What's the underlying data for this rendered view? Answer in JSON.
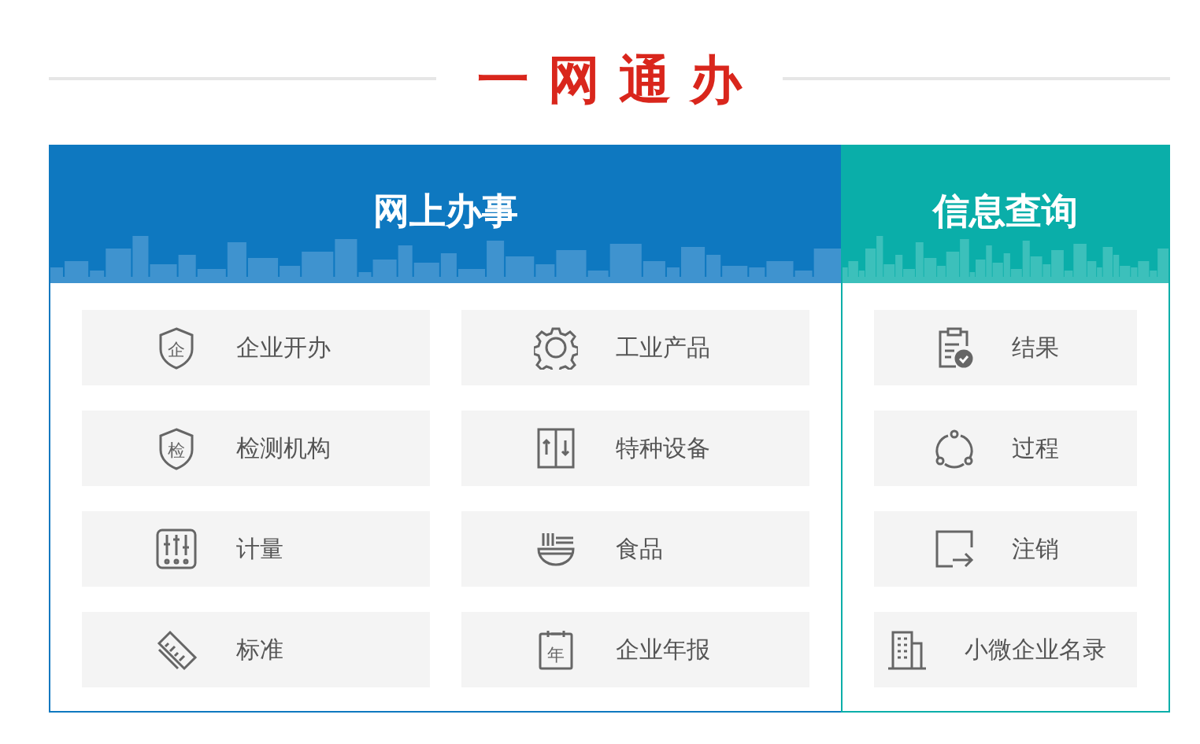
{
  "title": "一网通办",
  "panels": [
    {
      "title": "网上办事",
      "items": [
        {
          "label": "企业开办",
          "icon_text": "企"
        },
        {
          "label": "工业产品"
        },
        {
          "label": "检测机构",
          "icon_text": "检"
        },
        {
          "label": "特种设备"
        },
        {
          "label": "计量"
        },
        {
          "label": "食品"
        },
        {
          "label": "标准"
        },
        {
          "label": "企业年报",
          "icon_text": "年"
        }
      ]
    },
    {
      "title": "信息查询",
      "items": [
        {
          "label": "结果"
        },
        {
          "label": "过程"
        },
        {
          "label": "注销"
        },
        {
          "label": "小微企业名录"
        }
      ]
    }
  ]
}
